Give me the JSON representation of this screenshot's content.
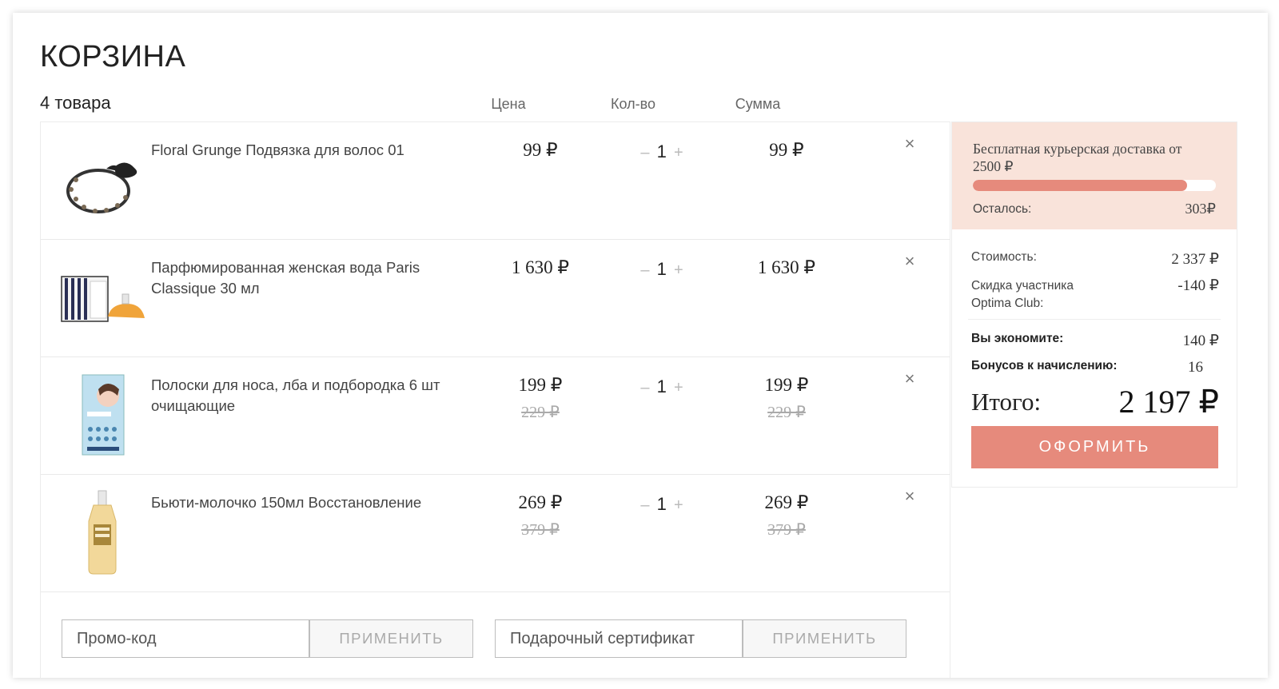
{
  "page_title": "КОРЗИНА",
  "items_count": "4 товара",
  "columns": {
    "price": "Цена",
    "qty": "Кол-во",
    "sum": "Сумма"
  },
  "items": [
    {
      "name": "Floral Grunge Подвязка для волос 01",
      "price": "99 ₽",
      "old_price": "",
      "qty": "1",
      "sum": "99 ₽",
      "old_sum": "",
      "image": "hair-band-icon"
    },
    {
      "name": "Парфюмированная женская вода Paris Classique 30 мл",
      "price": "1 630 ₽",
      "old_price": "",
      "qty": "1",
      "sum": "1 630 ₽",
      "old_sum": "",
      "image": "perfume-box-icon"
    },
    {
      "name": "Полоски для носа, лба и подбородка 6 шт очищающие",
      "price": "199 ₽",
      "old_price": "229 ₽",
      "qty": "1",
      "sum": "199 ₽",
      "old_sum": "229 ₽",
      "image": "nose-strips-box-icon"
    },
    {
      "name": "Бьюти-молочко 150мл Восстановление",
      "price": "269 ₽",
      "old_price": "379 ₽",
      "qty": "1",
      "sum": "269 ₽",
      "old_sum": "379 ₽",
      "image": "milk-bottle-icon"
    }
  ],
  "qty_controls": {
    "minus": "–",
    "plus": "+"
  },
  "remove_symbol": "×",
  "promo": {
    "promo_placeholder": "Промо-код",
    "apply_label": "ПРИМЕНИТЬ",
    "gift_placeholder": "Подарочный сертификат"
  },
  "summary": {
    "delivery_text": "Бесплатная курьерская доставка от 2500 ₽",
    "delivery_progress": 0.88,
    "left_label": "Осталось:",
    "left_value": "303₽",
    "cost_label": "Стоимость:",
    "cost_value": "2 337 ₽",
    "discount_label": "Скидка участника Optima Club:",
    "discount_value": "-140 ₽",
    "save_label": "Вы экономите:",
    "save_value": "140 ₽",
    "bonus_label": "Бонусов к начислению:",
    "bonus_value": "16",
    "total_label": "Итого:",
    "total_value": "2 197 ₽",
    "checkout_label": "ОФОРМИТЬ"
  },
  "colors": {
    "accent": "#e68a7c",
    "delivery_bg": "#f9e3da"
  }
}
